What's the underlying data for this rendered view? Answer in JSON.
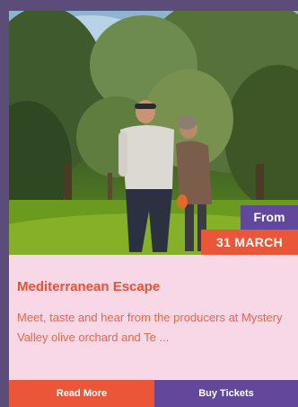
{
  "event": {
    "badge_prefix": "From",
    "badge_date": "31 MARCH",
    "title": "Mediterranean Escape",
    "description": "Meet, taste and hear from the producers at Mystery Valley olive orchard and Te ..."
  },
  "actions": {
    "read_more": "Read More",
    "buy_tickets": "Buy Tickets"
  },
  "colors": {
    "accent_orange": "#ec5638",
    "accent_purple": "#62479a",
    "card_bg": "#f8d8e6",
    "page_bg": "#5b4c7a"
  }
}
